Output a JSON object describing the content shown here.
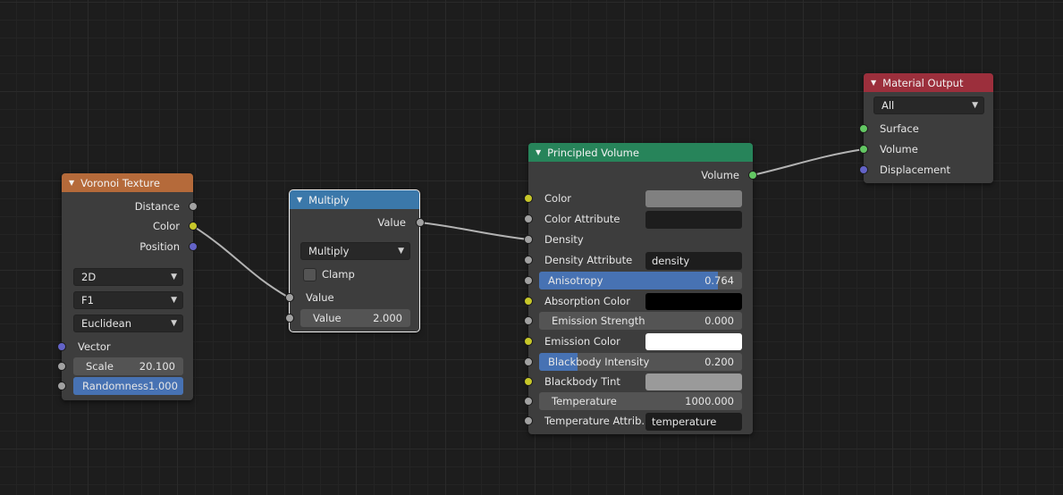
{
  "voronoi": {
    "title": "Voronoi Texture",
    "header_color": "#b56a3a",
    "outputs": [
      "Distance",
      "Color",
      "Position"
    ],
    "dimensions": "2D",
    "feature": "F1",
    "metric": "Euclidean",
    "vector_label": "Vector",
    "scale_label": "Scale",
    "scale_value": "20.100",
    "randomness_label": "Randomness",
    "randomness_value": "1.000",
    "randomness_fraction": 1.0
  },
  "multiply": {
    "title": "Multiply",
    "header_color": "#3b78aa",
    "output_label": "Value",
    "operation": "Multiply",
    "clamp_label": "Clamp",
    "clamp_checked": false,
    "input1_label": "Value",
    "input2_label": "Value",
    "input2_value": "2.000"
  },
  "principled_volume": {
    "title": "Principled Volume",
    "header_color": "#27845a",
    "output_label": "Volume",
    "color_label": "Color",
    "color_swatch": "#808080",
    "color_attribute_label": "Color Attribute",
    "color_attribute_value": "",
    "density_label": "Density",
    "density_attribute_label": "Density Attribute",
    "density_attribute_value": "density",
    "anisotropy_label": "Anisotropy",
    "anisotropy_value": "0.764",
    "anisotropy_fraction": 0.88,
    "absorption_color_label": "Absorption Color",
    "absorption_color_swatch": "#000000",
    "emission_strength_label": "Emission Strength",
    "emission_strength_value": "0.000",
    "emission_color_label": "Emission Color",
    "emission_color_swatch": "#ffffff",
    "blackbody_intensity_label": "Blackbody Intensity",
    "blackbody_intensity_value": "0.200",
    "blackbody_intensity_fraction": 0.2,
    "blackbody_tint_label": "Blackbody Tint",
    "blackbody_tint_swatch": "#9a9a9a",
    "temperature_label": "Temperature",
    "temperature_value": "1000.000",
    "temperature_attribute_label": "Temperature Attrib..",
    "temperature_attribute_value": "temperature"
  },
  "material_output": {
    "title": "Material Output",
    "header_color": "#9c2f3c",
    "target": "All",
    "inputs": [
      "Surface",
      "Volume",
      "Displacement"
    ]
  },
  "colors": {
    "canvas": "#1d1d1d",
    "node_body": "#3d3d3d",
    "link": "#b3b3b3",
    "slider_fill": "#4772b3"
  },
  "icons": {
    "collapse": "triangle-down-icon",
    "dropdown": "chevron-down-icon"
  }
}
